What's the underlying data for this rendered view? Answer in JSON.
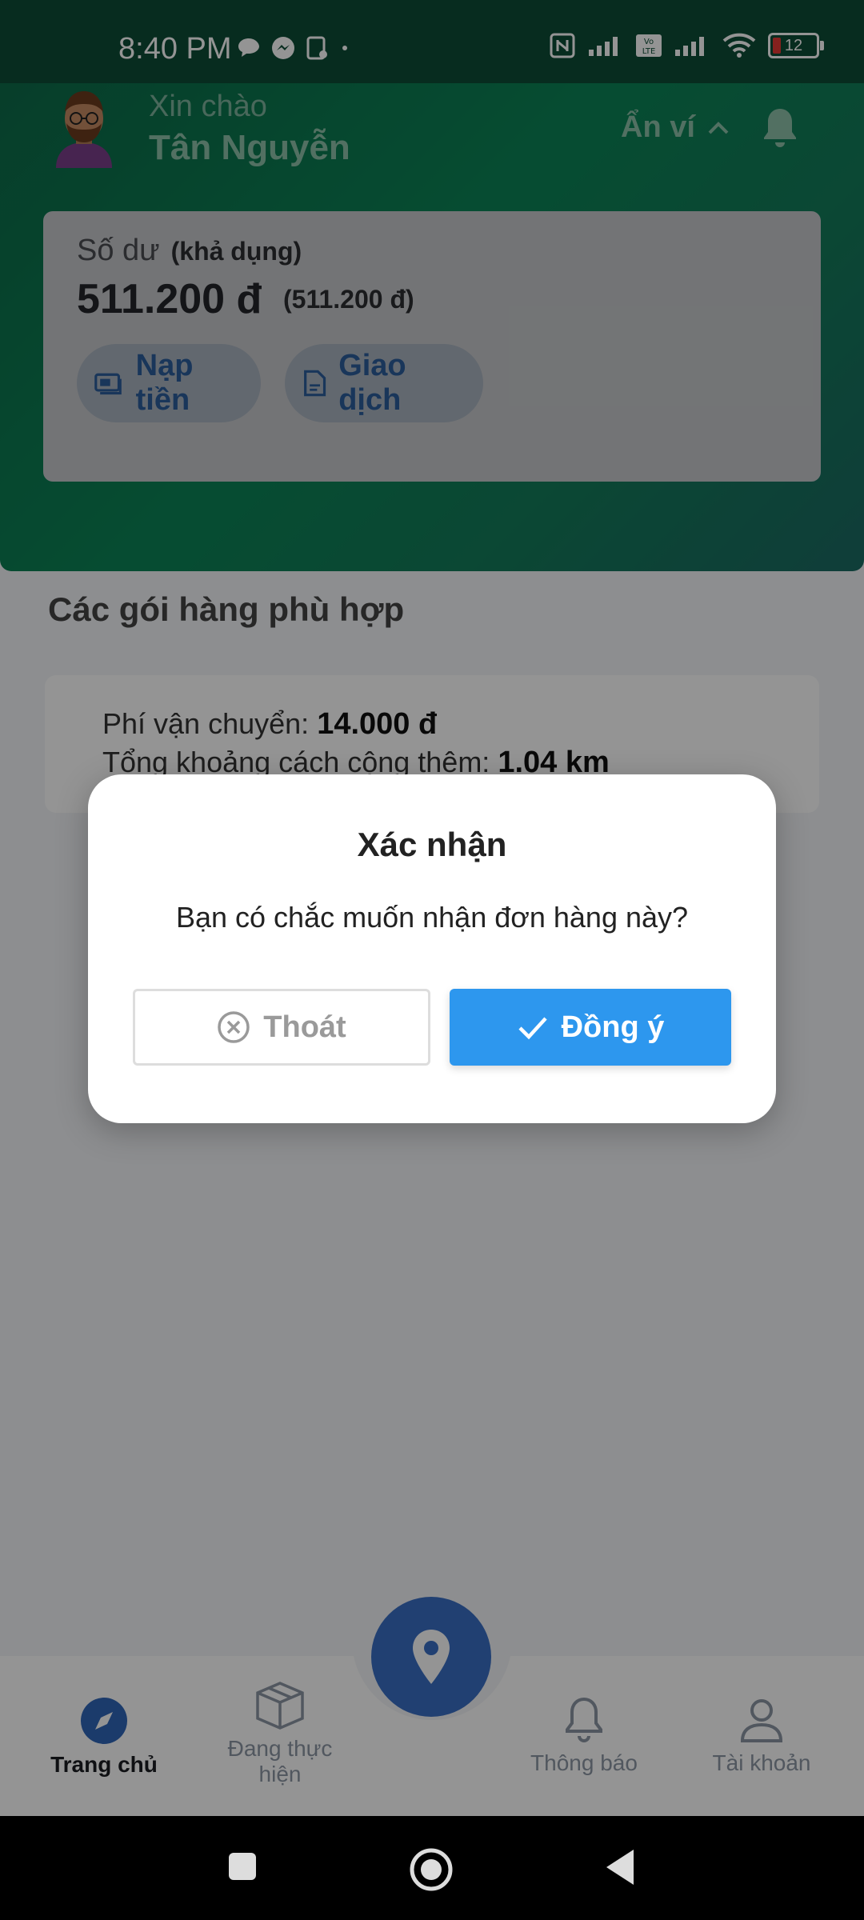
{
  "status_bar": {
    "time": "8:40 PM",
    "battery": "12",
    "icons": [
      "chat-bubble-icon",
      "messenger-icon",
      "sim-card-icon",
      "nfc-icon",
      "signal-icon",
      "volte-icon",
      "signal-icon",
      "wifi-icon",
      "battery-icon"
    ]
  },
  "header": {
    "greeting": "Xin chào",
    "username": "Tân Nguyễn",
    "hide_wallet_label": "Ẩn ví"
  },
  "balance": {
    "label": "Số dư",
    "sub_label": "(khả dụng)",
    "amount": "511.200 đ",
    "available": "(511.200 đ)",
    "topup_label": "Nạp tiền",
    "transactions_label": "Giao dịch"
  },
  "content": {
    "section_title": "Các gói hàng phù hợp",
    "package": {
      "shipping_label": "Phí vận chuyển:",
      "shipping_value": "14.000 đ",
      "distance_label": "Tổng khoảng cách cộng thêm:",
      "distance_value": "1.04 km"
    }
  },
  "dialog": {
    "title": "Xác nhận",
    "message": "Bạn có chắc muốn nhận đơn hàng này?",
    "cancel_label": "Thoát",
    "confirm_label": "Đồng ý"
  },
  "bottom_nav": {
    "home": "Trang chủ",
    "in_progress": "Đang thực hiện",
    "notifications": "Thông báo",
    "account": "Tài khoản"
  },
  "colors": {
    "header_green": "#0b8456",
    "primary_blue": "#2d97ee",
    "fab_blue": "#3a6fc4"
  }
}
